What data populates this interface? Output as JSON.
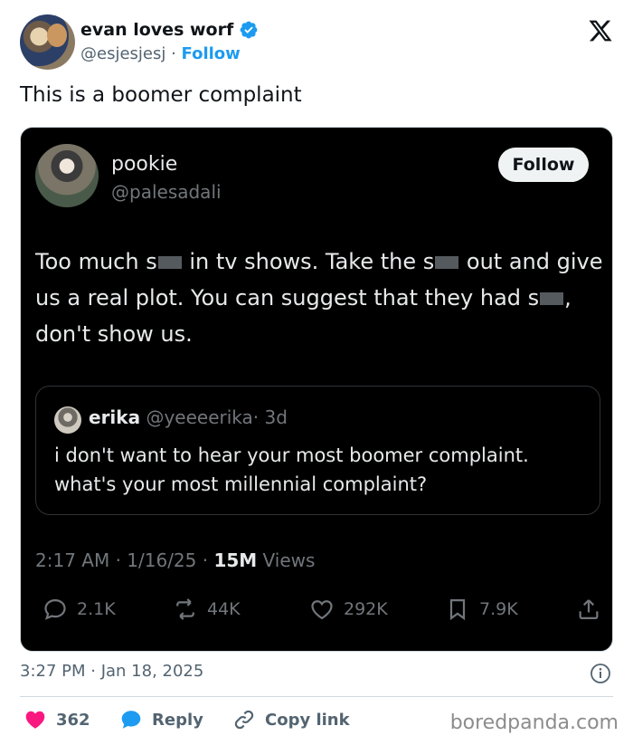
{
  "author": {
    "display_name": "evan loves worf",
    "handle": "@esjesjesj",
    "separator": " · ",
    "follow_label": "Follow"
  },
  "tweet": {
    "text": "This is a boomer complaint",
    "timestamp": "3:27 PM · Jan 18, 2025"
  },
  "embedded": {
    "name": "pookie",
    "handle": "@palesadali",
    "follow_label": "Follow",
    "body_parts": [
      "Too much s",
      " in tv shows. Take the s",
      " out and give us a real plot. You can suggest that they had s",
      ", don't show us."
    ],
    "quote": {
      "name": "erika",
      "handle": "@yeeeerika",
      "age": "· 3d",
      "text": "i don't want to hear your most boomer complaint. what's your most millennial complaint?"
    },
    "stamp_prefix": "2:17 AM · 1/16/25 · ",
    "views_count": "15M",
    "views_label": " Views",
    "actions": {
      "replies": "2.1K",
      "reposts": "44K",
      "likes": "292K",
      "bookmarks": "7.9K"
    }
  },
  "footer": {
    "likes": "362",
    "reply_label": "Reply",
    "copy_label": "Copy link"
  },
  "watermark": "boredpanda.com",
  "colors": {
    "accent": "#1d9bf0",
    "like": "#f91880",
    "muted": "#536471"
  },
  "icons": [
    "verified-badge-icon",
    "x-logo-icon",
    "reply-icon",
    "repost-icon",
    "heart-icon",
    "bookmark-icon",
    "share-icon",
    "info-icon",
    "link-icon"
  ]
}
